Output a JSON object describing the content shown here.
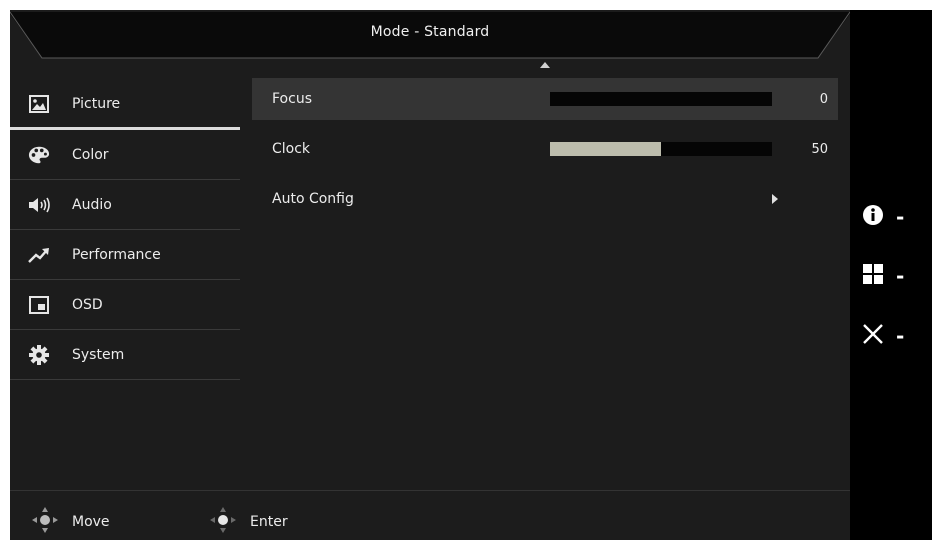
{
  "header": {
    "title": "Mode - Standard"
  },
  "sidebar": {
    "items": [
      {
        "label": "Picture",
        "icon": "picture-icon",
        "active": true
      },
      {
        "label": "Color",
        "icon": "palette-icon"
      },
      {
        "label": "Audio",
        "icon": "speaker-icon"
      },
      {
        "label": "Performance",
        "icon": "trend-icon"
      },
      {
        "label": "OSD",
        "icon": "osd-window-icon"
      },
      {
        "label": "System",
        "icon": "gear-icon"
      }
    ]
  },
  "settings": [
    {
      "label": "Focus",
      "value": "0",
      "level": 0
    },
    {
      "label": "Clock",
      "value": "50",
      "level": 0.5
    },
    {
      "label": "Auto Config",
      "type": "submenu"
    }
  ],
  "footer": {
    "move_label": "Move",
    "enter_label": "Enter"
  },
  "hotkeys": [
    {
      "icon": "info-icon"
    },
    {
      "icon": "menu-grid-icon"
    },
    {
      "icon": "close-icon"
    }
  ],
  "colors": {
    "panel_bg": "#1c1c1c",
    "highlight": "#343434",
    "bar_fill": "#bcbcac",
    "bar_track": "#050505"
  }
}
